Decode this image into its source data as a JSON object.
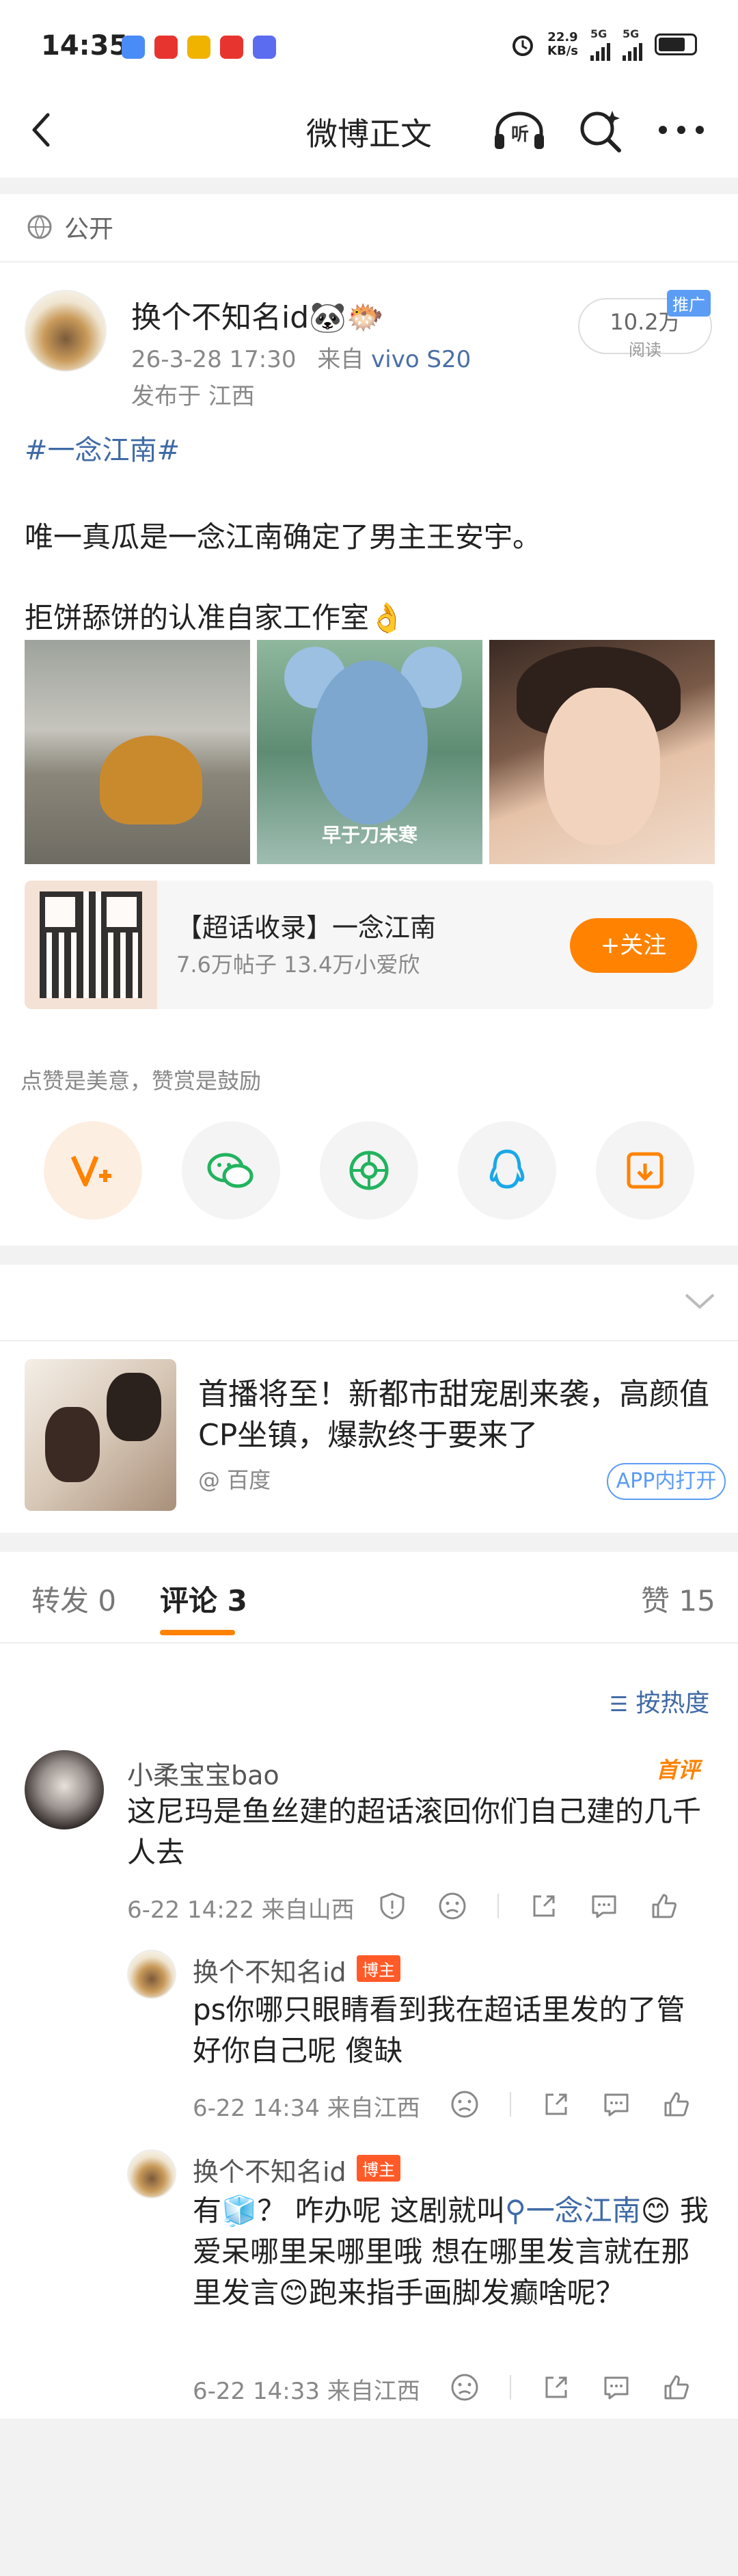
{
  "status_bar": {
    "time": "14:35",
    "net_speed_value": "22.9",
    "net_speed_unit": "KB/s",
    "sim1": "5G",
    "sim2": "5G",
    "app_icon_colors": [
      "#4a8cf7",
      "#e8342e",
      "#f0b400",
      "#e8342e",
      "#5b6cf0"
    ]
  },
  "nav": {
    "title": "微博正文",
    "listen_label": "听"
  },
  "post": {
    "visibility": "公开",
    "author": "换个不知名id🐼🐡",
    "time": "26-3-28 17:30",
    "source_prefix": "来自",
    "device": "vivo S20",
    "location": "发布于 江西",
    "reads": "10.2万",
    "reads_label": "阅读",
    "promo_badge": "推广",
    "topic": "#一念江南#",
    "text1": "唯一真瓜是一念江南确定了男主王安宇。",
    "text2": "拒饼舔饼的认准自家工作室👌",
    "image2_caption": "早于刀未寒"
  },
  "supertopic": {
    "title": "【超话收录】一念江南",
    "stats": "7.6万帖子 13.4万小爱欣",
    "follow_label": "+关注"
  },
  "reward_tip": "点赞是美意，赞赏是鼓励",
  "share_icons": [
    "reward-v-icon",
    "wechat-icon",
    "moments-icon",
    "qq-icon",
    "save-image-icon"
  ],
  "ad": {
    "text": "首播将至！新都市甜宠剧来袭，高颜值CP坐镇，爆款终于要来了",
    "source": "@ 百度",
    "button": "APP内打开"
  },
  "tabs": {
    "repost": "转发 0",
    "comments": "评论 3",
    "likes": "赞 15"
  },
  "sort_label": "按热度",
  "comments": [
    {
      "name": "小柔宝宝bao",
      "badge": "首评",
      "text": "这尼玛是鱼丝建的超话滚回你们自己建的几千人去",
      "meta": "6-22 14:22  来自山西"
    },
    {
      "name": "换个不知名id",
      "badge": "博主",
      "text": "ps你哪只眼睛看到我在超话里发的了管好你自己呢 傻缺",
      "meta": "6-22 14:34  来自江西"
    },
    {
      "name": "换个不知名id",
      "badge": "博主",
      "text_a": "有🧊？ 咋办呢 这剧就叫",
      "topic": "一念江南",
      "text_b": "😊 我爱呆哪里呆哪里哦 想在哪里发言就在那里发言😊跑来指手画脚发癫啥呢？",
      "meta": "6-22 14:33  来自江西"
    }
  ]
}
